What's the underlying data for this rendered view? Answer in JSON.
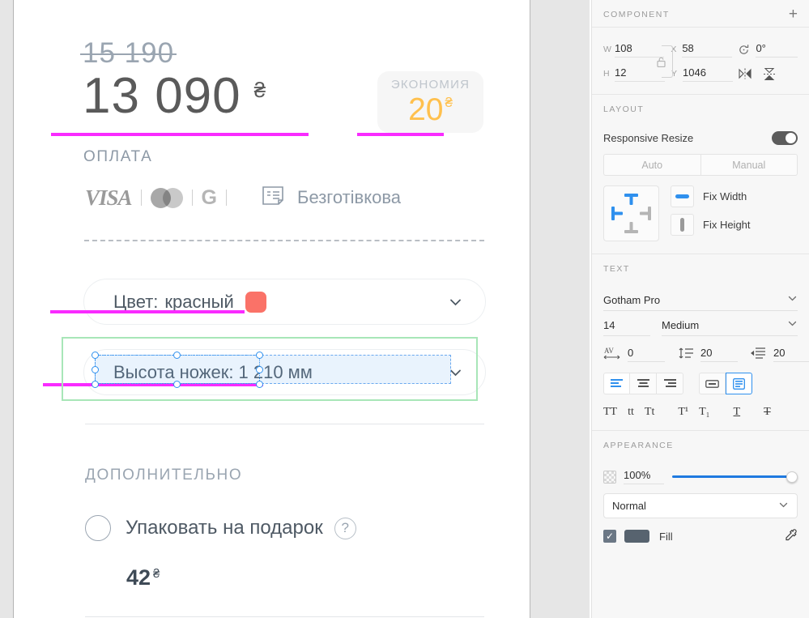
{
  "canvas": {
    "old_price": "15 190",
    "price": "13 090",
    "currency": "₴",
    "payment_label": "ОПЛАТА",
    "savings": {
      "title": "ЭКОНОМИЯ",
      "value": "20",
      "currency": "₴"
    },
    "payment_methods": {
      "visa": "VISA",
      "mastercard_icon": "mastercard-icon",
      "google_pay_icon": "G",
      "apple_pay_icon": "",
      "cashless_icon": "invoice-icon",
      "cashless_label": "Безготівкова"
    },
    "color_select": {
      "label": "Цвет:",
      "value": "красный",
      "swatch": "#fa7268"
    },
    "height_select": {
      "label": "Высота ножек:",
      "value": "1 210 мм"
    },
    "additional": {
      "title": "ДОПОЛНИТЕЛЬНО",
      "gift_label": "Упаковать на подарок",
      "help": "?",
      "gift_price": "42",
      "gift_currency": "₴"
    },
    "highlight_color": "#f92bff",
    "selection_color": "#2f90ee",
    "group_outline_color": "#a8e6b8"
  },
  "panel": {
    "component": {
      "title": "COMPONENT",
      "add": "+",
      "w_label": "W",
      "w_value": "108",
      "h_label": "H",
      "h_value": "12",
      "x_label": "X",
      "x_value": "58",
      "y_label": "Y",
      "y_value": "1046",
      "rotation_icon": "rotate-icon",
      "rotation_value": "0°",
      "flip_h_icon": "flip-horizontal-icon",
      "flip_v_icon": "flip-vertical-icon",
      "lock_icon": "lock-open-icon"
    },
    "layout": {
      "title": "LAYOUT",
      "responsive_label": "Responsive Resize",
      "responsive_on": true,
      "auto": "Auto",
      "manual": "Manual",
      "fix_width": "Fix Width",
      "fix_height": "Fix Height",
      "constraints_icon": "constraints-icon"
    },
    "text": {
      "title": "TEXT",
      "font_family": "Gotham Pro",
      "font_size": "14",
      "font_weight": "Medium",
      "letter_spacing_icon": "letter-spacing-icon",
      "letter_spacing": "0",
      "line_height_icon": "line-height-icon",
      "line_height": "20",
      "paragraph_spacing_icon": "paragraph-spacing-icon",
      "paragraph_spacing": "20",
      "align_left_icon": "align-left-icon",
      "align_center_icon": "align-center-icon",
      "align_right_icon": "align-right-icon",
      "resize_fixed_icon": "text-fixed-size-icon",
      "resize_auto_icon": "text-auto-height-icon",
      "uppercase": "TT",
      "lowercase": "tt",
      "titlecase": "Tt",
      "superscript": "T¹",
      "subscript": "T₁",
      "underline": "T",
      "strikethrough": "T"
    },
    "appearance": {
      "title": "APPEARANCE",
      "opacity_icon": "transparency-icon",
      "opacity": "100%",
      "blend_mode": "Normal",
      "fill_label": "Fill",
      "fill_color": "#57636f",
      "fill_checked": true,
      "eyedropper_icon": "eyedropper-icon"
    }
  }
}
